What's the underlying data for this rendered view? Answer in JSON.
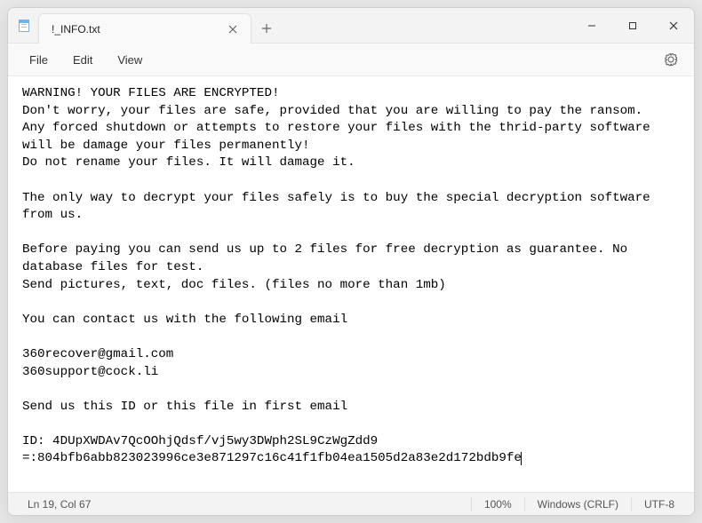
{
  "titlebar": {
    "tab_title": "!_INFO.txt"
  },
  "menubar": {
    "file": "File",
    "edit": "Edit",
    "view": "View"
  },
  "document": {
    "text": "WARNING! YOUR FILES ARE ENCRYPTED!\nDon't worry, your files are safe, provided that you are willing to pay the ransom.\nAny forced shutdown or attempts to restore your files with the thrid-party software\nwill be damage your files permanently!\nDo not rename your files. It will damage it.\n\nThe only way to decrypt your files safely is to buy the special decryption software\nfrom us.\n\nBefore paying you can send us up to 2 files for free decryption as guarantee. No\ndatabase files for test.\nSend pictures, text, doc files. (files no more than 1mb)\n\nYou can contact us with the following email\n\n360recover@gmail.com\n360support@cock.li\n\nSend us this ID or this file in first email\n\nID: 4DUpXWDAv7QcOOhjQdsf/vj5wy3DWph2SL9CzWgZdd9\n=:804bfb6abb823023996ce3e871297c16c41f1fb04ea1505d2a83e2d172bdb9fe"
  },
  "statusbar": {
    "position": "Ln 19, Col 67",
    "zoom": "100%",
    "line_ending": "Windows (CRLF)",
    "encoding": "UTF-8"
  }
}
